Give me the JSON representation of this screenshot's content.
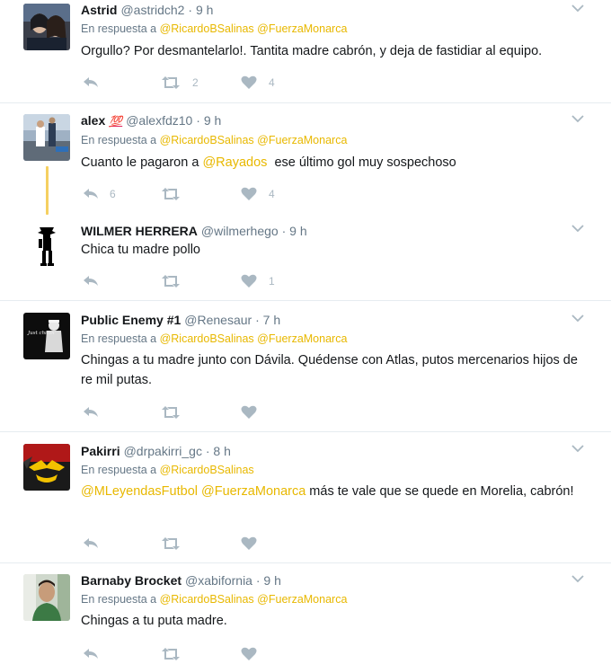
{
  "tweets": [
    {
      "name": "Astrid",
      "handle": "@astridch2",
      "time": "9 h",
      "reply_prefix": "En respuesta a",
      "reply_to": [
        "@RicardoBSalinas",
        "@FuerzaMonarca"
      ],
      "text": "Orgullo? Por desmantelarlo!. Tantita madre cabrón, y deja de fastidiar al equipo.",
      "replies": "",
      "retweets": "2",
      "likes": "4"
    },
    {
      "name": "alex",
      "badge": "💯",
      "handle": "@alexfdz10",
      "time": "9 h",
      "reply_prefix": "En respuesta a",
      "reply_to": [
        "@RicardoBSalinas",
        "@FuerzaMonarca"
      ],
      "text_before": "Cuanto le pagaron a ",
      "text_link": "@Rayados",
      "text_after": "  ese último gol muy sospechoso",
      "replies": "6",
      "retweets": "",
      "likes": "4"
    },
    {
      "name": "WILMER HERRERA",
      "handle": "@wilmerhego",
      "time": "9 h",
      "text": "Chica tu madre pollo",
      "replies": "",
      "retweets": "",
      "likes": "1"
    },
    {
      "name": "Public Enemy #1",
      "handle": "@Renesaur",
      "time": "7 h",
      "reply_prefix": "En respuesta a",
      "reply_to": [
        "@RicardoBSalinas",
        "@FuerzaMonarca"
      ],
      "text": "Chingas a tu madre junto con Dávila. Quédense con Atlas, putos mercenarios hijos de re mil putas.",
      "replies": "",
      "retweets": "",
      "likes": ""
    },
    {
      "name": "Pakirri",
      "handle": "@drpakirri_gc",
      "time": "8 h",
      "reply_prefix": "En respuesta a",
      "reply_to": [
        "@RicardoBSalinas"
      ],
      "text_link1": "@MLeyendasFutbol",
      "text_link2": "@FuerzaMonarca",
      "text_after": " más te vale que se quede en Morelia, cabrón!",
      "replies": "",
      "retweets": "",
      "likes": ""
    },
    {
      "name": "Barnaby Brocket",
      "handle": "@xabifornia",
      "time": "9 h",
      "reply_prefix": "En respuesta a",
      "reply_to": [
        "@RicardoBSalinas",
        "@FuerzaMonarca"
      ],
      "text": "Chingas a tu puta madre.",
      "replies": "",
      "retweets": "",
      "likes": ""
    }
  ],
  "icons": {
    "reply": "reply-icon",
    "retweet": "retweet-icon",
    "like": "heart-icon",
    "more": "chevron-down-icon"
  },
  "colors": {
    "mention": "#e8b800",
    "muted": "#657786",
    "icon": "#aab8c2",
    "thread_line": "#f5d061"
  },
  "avatar_captions": {
    "public_enemy": "Just chillin'"
  }
}
